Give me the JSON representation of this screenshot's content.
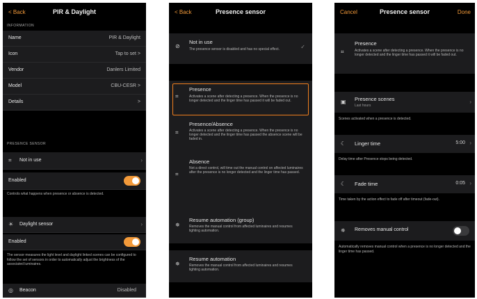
{
  "screen1": {
    "nav": {
      "back": "< Back",
      "title": "PIR & Daylight"
    },
    "info_header": "INFORMATION",
    "info_rows": [
      {
        "label": "Name",
        "value": "PIR & Daylight"
      },
      {
        "label": "Icon",
        "value": "Tap to set >"
      },
      {
        "label": "Vendor",
        "value": "Danlers Limited"
      },
      {
        "label": "Model",
        "value": "CBU-CESR >"
      },
      {
        "label": "Details",
        "value": ">"
      }
    ],
    "presence_header": "PRESENCE SENSOR",
    "not_in_use": "Not in use",
    "enabled1": "Enabled",
    "enabled1_on": true,
    "presence_note": "Controls what happens when presence or absence is detected.",
    "daylight_label": "Daylight sensor",
    "enabled2": "Enabled",
    "enabled2_on": true,
    "daylight_note": "The sensor measures the light level and daylight linked scenes can be configured to follow the set of sensors in order to automatically adjust the brightness of the associated luminaires.",
    "bottom_label": "Beacon",
    "bottom_value": "Disabled"
  },
  "screen2": {
    "nav": {
      "back": "< Back",
      "title": "Presence sensor"
    },
    "options": [
      {
        "title": "Not in use",
        "desc": "The presence sensor is disabled and has no special effect."
      },
      {
        "title": "Presence",
        "desc": "Activates a scene after detecting a presence. When the presence is no longer detected and the linger time has passed it will be faded out."
      },
      {
        "title": "Presence/Absence",
        "desc": "Activates a scene after detecting a presence. When the presence is no longer detected and the linger time has passed the absence scene will be faded in."
      },
      {
        "title": "Absence",
        "desc": "Not a direct control, will time out the manual control on affected luminaires after the presence is no longer detected and the linger time has passed."
      },
      {
        "title": "Resume automation (group)",
        "desc": "Removes the manual control from affected luminaires and resumes lighting automation."
      },
      {
        "title": "Resume automation",
        "desc": "Removes the manual control from affected luminaires and resumes lighting automation."
      }
    ]
  },
  "screen3": {
    "nav": {
      "cancel": "Cancel",
      "title": "Presence sensor",
      "done": "Done"
    },
    "presence": {
      "title": "Presence",
      "desc": "Activates a scene after detecting a presence. When the presence is no longer detected and the linger time has passed it will be faded out."
    },
    "scenes": {
      "title": "Presence scenes",
      "sub": "Last hours"
    },
    "scenes_note": "Scenes activated when a presence is detected.",
    "linger": {
      "label": "Linger time",
      "value": "5:00"
    },
    "linger_note": "Delay time after Presence stops being detected.",
    "fade": {
      "label": "Fade time",
      "value": "0:05"
    },
    "fade_note": "Time taken by the action effect to fade off after timeout (fade-out).",
    "manual": {
      "label": "Removes manual control",
      "on": false
    },
    "manual_note": "Automatically removes manual control when a presence is no longer detected and the linger time has passed."
  }
}
